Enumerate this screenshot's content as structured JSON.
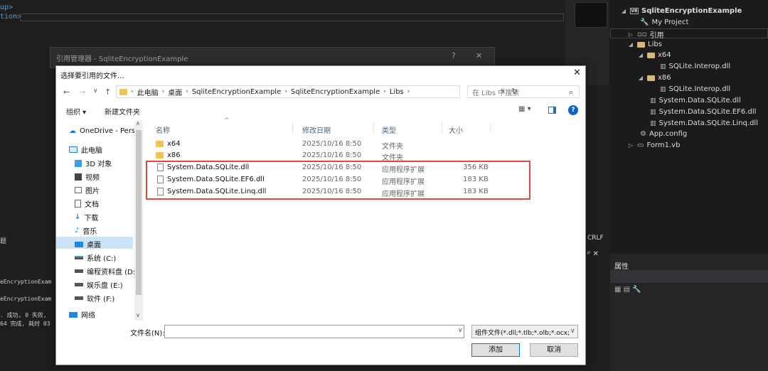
{
  "ide": {
    "code_lines": [
      "up>",
      "tion>"
    ],
    "output_lines": [
      "eEncryptionExam",
      "eEncryptionExam",
      ". 成功, 0 失败,",
      "64 完成, 耗时 03"
    ],
    "output_header": "题",
    "crlf": "CRLF"
  },
  "solution_explorer": {
    "items": [
      {
        "label": "SqliteEncryptionExample",
        "kind": "project",
        "arrow": "◢"
      },
      {
        "label": "My Project",
        "kind": "wrench",
        "arrow": ""
      },
      {
        "label": "引用",
        "kind": "refs",
        "arrow": "▷"
      },
      {
        "label": "Libs",
        "kind": "folder",
        "arrow": "◢"
      },
      {
        "label": "x64",
        "kind": "folder",
        "arrow": "◢"
      },
      {
        "label": "SQLite.Interop.dll",
        "kind": "dll",
        "arrow": ""
      },
      {
        "label": "x86",
        "kind": "folder",
        "arrow": "◢"
      },
      {
        "label": "SQLite.Interop.dll",
        "kind": "dll",
        "arrow": ""
      },
      {
        "label": "System.Data.SQLite.dll",
        "kind": "dll",
        "arrow": ""
      },
      {
        "label": "System.Data.SQLite.EF6.dll",
        "kind": "dll",
        "arrow": ""
      },
      {
        "label": "System.Data.SQLite.Linq.dll",
        "kind": "dll",
        "arrow": ""
      },
      {
        "label": "App.config",
        "kind": "config",
        "arrow": ""
      },
      {
        "label": "Form1.vb",
        "kind": "form",
        "arrow": "▷"
      }
    ],
    "properties_title": "属性"
  },
  "ref_manager": {
    "title": "引用管理器 - SqliteEncryptionExample",
    "help": "?",
    "close": "✕"
  },
  "dialog": {
    "title": "选择要引用的文件...",
    "close": "✕",
    "breadcrumb": [
      "此电脑",
      "桌面",
      "SqliteEncryptionExample",
      "SqliteEncryptionExample",
      "Libs"
    ],
    "search_placeholder": "在 Libs 中搜索",
    "toolbar": {
      "organize": "组织 ▾",
      "new_folder": "新建文件夹"
    },
    "nav": [
      {
        "label": "OneDrive - Pers",
        "icon": "cloud-icon"
      },
      {
        "label": "此电脑",
        "icon": "computer-icon"
      },
      {
        "label": "3D 对象",
        "icon": "cube-icon"
      },
      {
        "label": "视频",
        "icon": "video-icon"
      },
      {
        "label": "图片",
        "icon": "picture-icon"
      },
      {
        "label": "文档",
        "icon": "document-icon"
      },
      {
        "label": "下载",
        "icon": "download-icon"
      },
      {
        "label": "音乐",
        "icon": "music-icon"
      },
      {
        "label": "桌面",
        "icon": "desktop-icon"
      },
      {
        "label": "系统 (C:)",
        "icon": "drive-icon"
      },
      {
        "label": "编程资料盘 (D:)",
        "icon": "drive-icon"
      },
      {
        "label": "娱乐盘 (E:)",
        "icon": "drive-icon"
      },
      {
        "label": "软件 (F:)",
        "icon": "drive-icon"
      },
      {
        "label": "网络",
        "icon": "network-icon"
      }
    ],
    "columns": {
      "name": "名称",
      "date": "修改日期",
      "type": "类型",
      "size": "大小"
    },
    "files": [
      {
        "name": "x64",
        "date": "2025/10/16 8:50",
        "type": "文件夹",
        "size": "",
        "kind": "folder"
      },
      {
        "name": "x86",
        "date": "2025/10/16 8:50",
        "type": "文件夹",
        "size": "",
        "kind": "folder"
      },
      {
        "name": "System.Data.SQLite.dll",
        "date": "2025/10/16 8:50",
        "type": "应用程序扩展",
        "size": "356 KB",
        "kind": "dll"
      },
      {
        "name": "System.Data.SQLite.EF6.dll",
        "date": "2025/10/16 8:50",
        "type": "应用程序扩展",
        "size": "183 KB",
        "kind": "dll"
      },
      {
        "name": "System.Data.SQLite.Linq.dll",
        "date": "2025/10/16 8:50",
        "type": "应用程序扩展",
        "size": "183 KB",
        "kind": "dll"
      }
    ],
    "filename_label": "文件名(N):",
    "filename_value": "",
    "filter": "组件文件(*.dll;*.tlb;*.olb;*.ocx;",
    "add_button": "添加",
    "cancel_button": "取消",
    "highlight_color": "#e0483e"
  }
}
